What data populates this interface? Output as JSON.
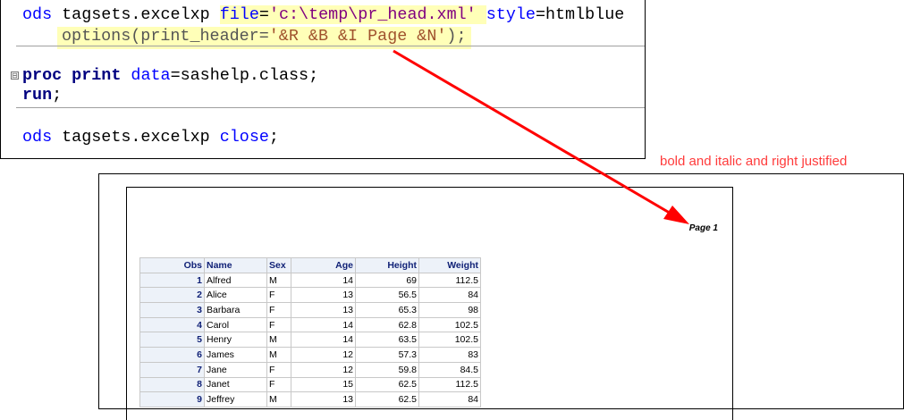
{
  "code": {
    "line1": {
      "kw1": "ods",
      "t1": " tagsets.excelxp ",
      "kw2": "file",
      "t2": "=",
      "s1": "'c:\\temp\\pr_head.xml'",
      "t3": " ",
      "kw3": "style",
      "t4": "=htmlblue"
    },
    "line2": {
      "t1": "options(print_header=",
      "s1": "'&R &B &I Page &N'",
      "t2": ");"
    },
    "line3": {
      "b1": "proc print",
      "t1": " ",
      "kw1": "data",
      "t2": "=sashelp.class;"
    },
    "line4": {
      "b1": "run",
      "t1": ";"
    },
    "line5": {
      "kw1": "ods",
      "t1": " tagsets.excelxp ",
      "kw2": "close",
      "t2": ";"
    },
    "fold": "⊟"
  },
  "annotation": "bold and italic and right justified",
  "preview": {
    "header_text": "Page 1",
    "columns": [
      "Obs",
      "Name",
      "Sex",
      "Age",
      "Height",
      "Weight"
    ],
    "rows": [
      [
        "1",
        "Alfred",
        "M",
        "14",
        "69",
        "112.5"
      ],
      [
        "2",
        "Alice",
        "F",
        "13",
        "56.5",
        "84"
      ],
      [
        "3",
        "Barbara",
        "F",
        "13",
        "65.3",
        "98"
      ],
      [
        "4",
        "Carol",
        "F",
        "14",
        "62.8",
        "102.5"
      ],
      [
        "5",
        "Henry",
        "M",
        "14",
        "63.5",
        "102.5"
      ],
      [
        "6",
        "James",
        "M",
        "12",
        "57.3",
        "83"
      ],
      [
        "7",
        "Jane",
        "F",
        "12",
        "59.8",
        "84.5"
      ],
      [
        "8",
        "Janet",
        "F",
        "15",
        "62.5",
        "112.5"
      ],
      [
        "9",
        "Jeffrey",
        "M",
        "13",
        "62.5",
        "84"
      ]
    ]
  },
  "colors": {
    "arrow": "#ff0000",
    "highlight": "#ffffb8"
  }
}
